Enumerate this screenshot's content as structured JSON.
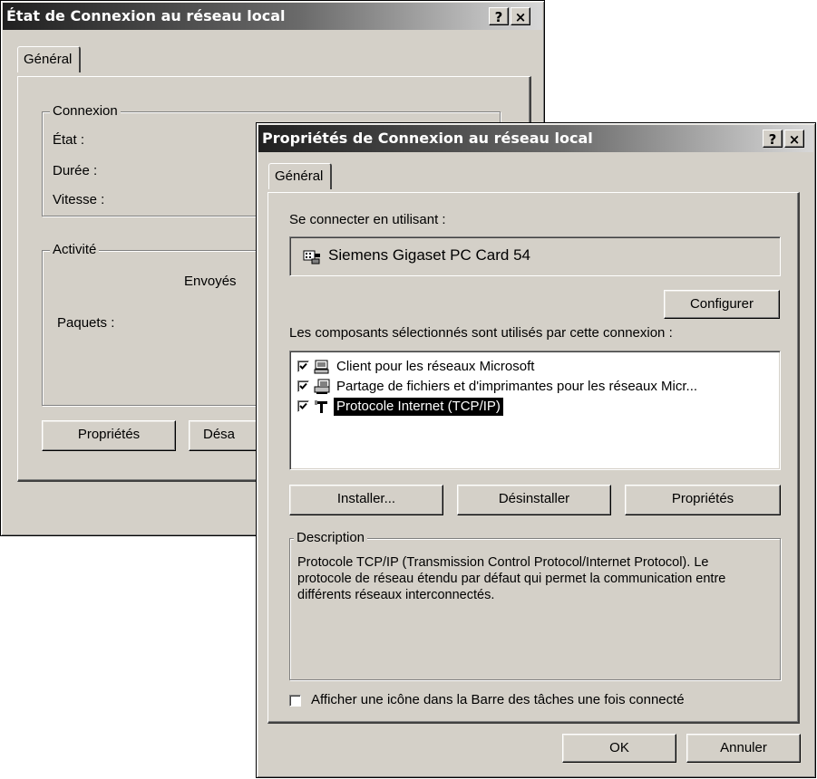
{
  "status_window": {
    "title": "État de Connexion au réseau local",
    "help_btn": "?",
    "close_btn": "×",
    "tab": "Général",
    "connexion_group": "Connexion",
    "etat_label": "État :",
    "duree_label": "Durée :",
    "vitesse_label": "Vitesse :",
    "activite_group": "Activité",
    "envoyes_label": "Envoyés",
    "paquets_label": "Paquets :",
    "proprietes_btn": "Propriétés",
    "desactiver_btn": "Désa"
  },
  "props_window": {
    "title": "Propriétés de Connexion au réseau local",
    "help_btn": "?",
    "close_btn": "×",
    "tab": "Général",
    "connect_using_label": "Se connecter en utilisant :",
    "adapter_name": "Siemens Gigaset PC Card 54",
    "configure_btn": "Configurer",
    "components_label": "Les composants sélectionnés sont utilisés par cette connexion :",
    "components": [
      {
        "label": "Client pour les réseaux Microsoft",
        "checked": true,
        "icon": "network-client-icon"
      },
      {
        "label": "Partage de fichiers et d'imprimantes pour les réseaux Micr...",
        "checked": true,
        "icon": "file-printer-sharing-icon"
      },
      {
        "label": "Protocole Internet (TCP/IP)",
        "checked": true,
        "icon": "protocol-icon",
        "selected": true
      }
    ],
    "install_btn": "Installer...",
    "uninstall_btn": "Désinstaller",
    "properties_btn": "Propriétés",
    "description_group": "Description",
    "description_text": "Protocole TCP/IP (Transmission Control Protocol/Internet Protocol). Le protocole de réseau étendu par défaut qui permet la communication entre différents réseaux interconnectés.",
    "tray_icon_label": "Afficher une icône dans la Barre des tâches une fois connecté",
    "tray_icon_checked": false,
    "ok_btn": "OK",
    "cancel_btn": "Annuler"
  }
}
